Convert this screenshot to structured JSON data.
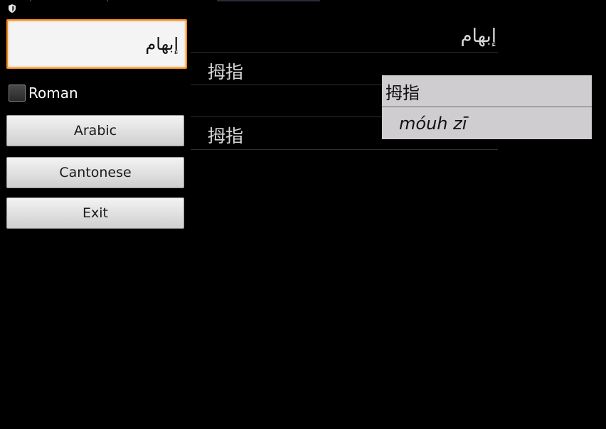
{
  "status_bar": {
    "icon": "shield-icon"
  },
  "search": {
    "value": "إبهام"
  },
  "roman_checkbox": {
    "label": "Roman",
    "checked": false
  },
  "buttons": {
    "arabic": "Arabic",
    "cantonese": "Cantonese",
    "exit": "Exit"
  },
  "results": {
    "header": "إبهام",
    "rows": [
      "拇指",
      "拇指"
    ]
  },
  "popup": {
    "chinese": "拇指",
    "romanization": "móuh zī"
  },
  "colors": {
    "focus_border": "#f28a1c",
    "background": "#000000",
    "popup_bg": "#cfcdd0"
  }
}
